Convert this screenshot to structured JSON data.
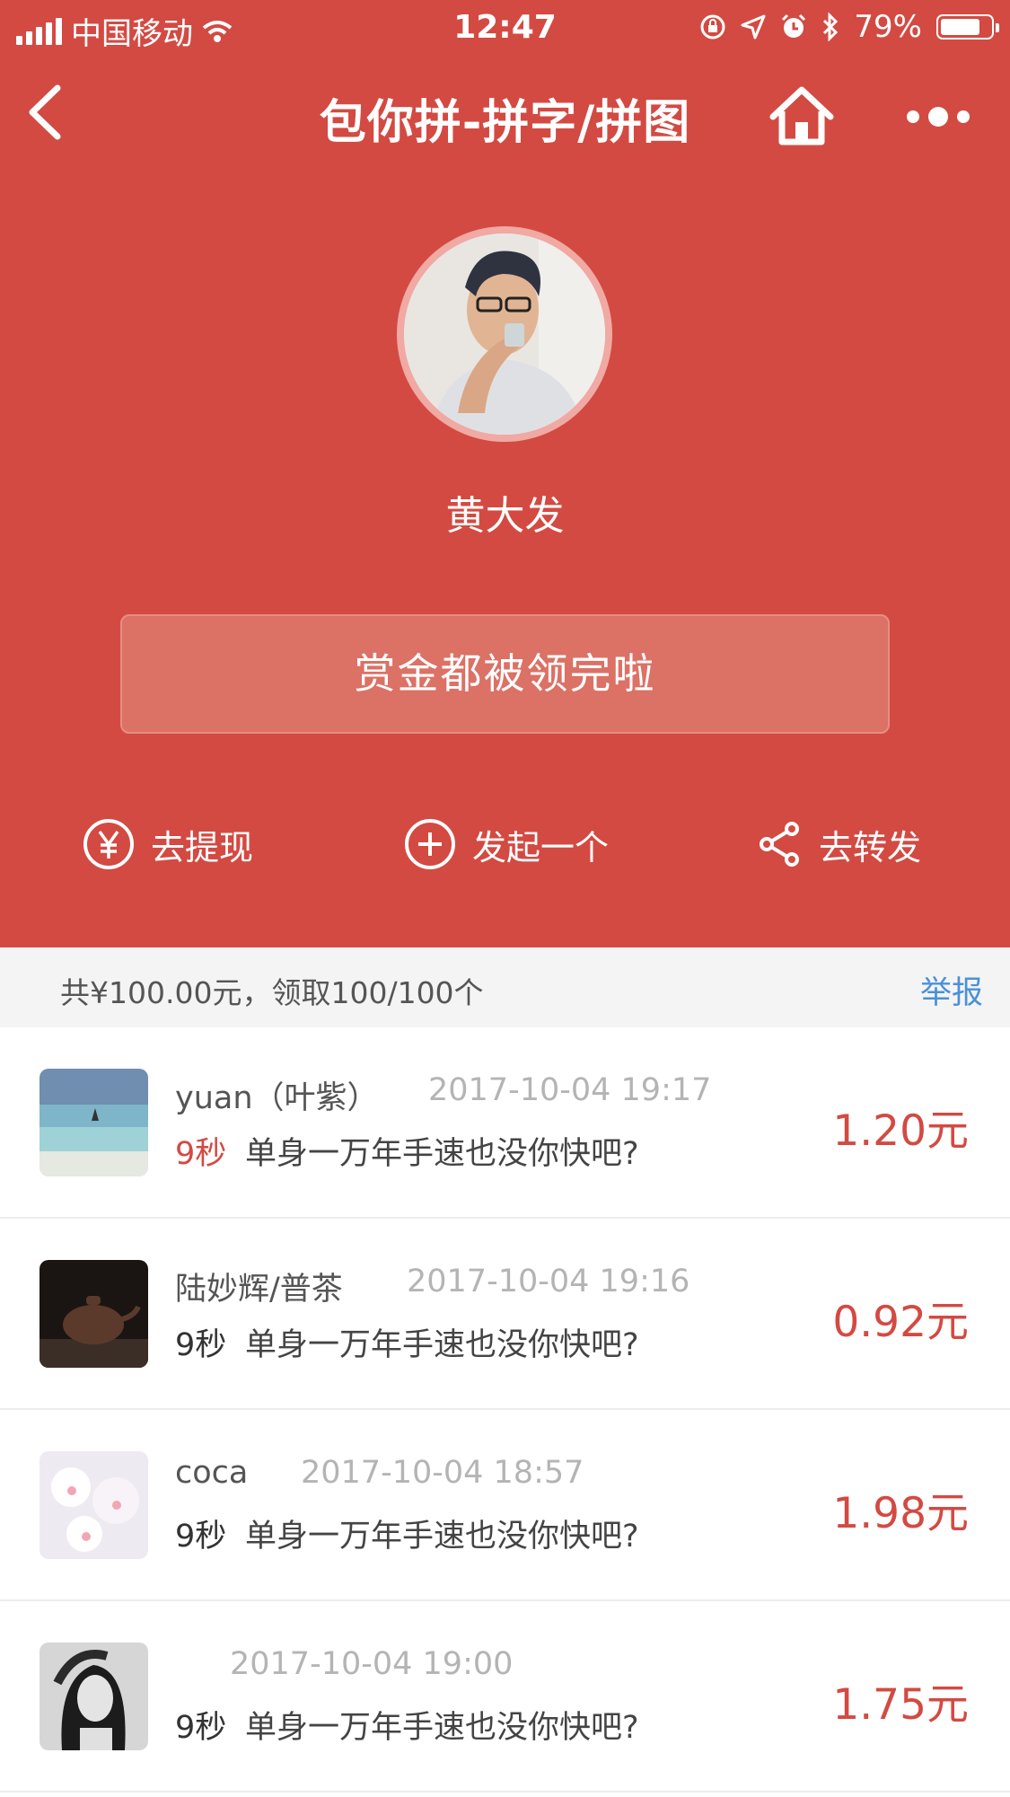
{
  "status_bar": {
    "carrier": "中国移动",
    "time": "12:47",
    "battery_percent": "79%",
    "battery_level": 0.79
  },
  "navbar": {
    "title": "包你拼-拼字/拼图",
    "back_icon": "chevron-left-icon",
    "home_icon": "home-icon",
    "more_icon": "more-dots-icon"
  },
  "profile": {
    "name": "黄大发"
  },
  "banner": {
    "text": "赏金都被领完啦"
  },
  "actions": [
    {
      "label": "去提现",
      "icon": "yen-circle-icon"
    },
    {
      "label": "发起一个",
      "icon": "plus-circle-icon"
    },
    {
      "label": "去转发",
      "icon": "share-icon"
    }
  ],
  "summary": {
    "text": "共¥100.00元，领取100/100个",
    "report_label": "举报"
  },
  "records": [
    {
      "name": "yuan（叶紫）",
      "date": "2017-10-04 19:17",
      "duration": "9秒",
      "message": "单身一万年手速也没你快吧?",
      "amount": "1.20元",
      "highlight": true
    },
    {
      "name": "陆妙辉/普茶",
      "date": "2017-10-04 19:16",
      "duration": "9秒",
      "message": "单身一万年手速也没你快吧?",
      "amount": "0.92元",
      "highlight": false
    },
    {
      "name": "coca",
      "date": "2017-10-04 18:57",
      "duration": "9秒",
      "message": "单身一万年手速也没你快吧?",
      "amount": "1.98元",
      "highlight": false
    },
    {
      "name": "",
      "date": "2017-10-04 19:00",
      "duration": "9秒",
      "message": "单身一万年手速也没你快吧?",
      "amount": "1.75元",
      "highlight": false
    }
  ],
  "colors": {
    "primary_red": "#d34a42",
    "link_blue": "#4a90d9"
  }
}
